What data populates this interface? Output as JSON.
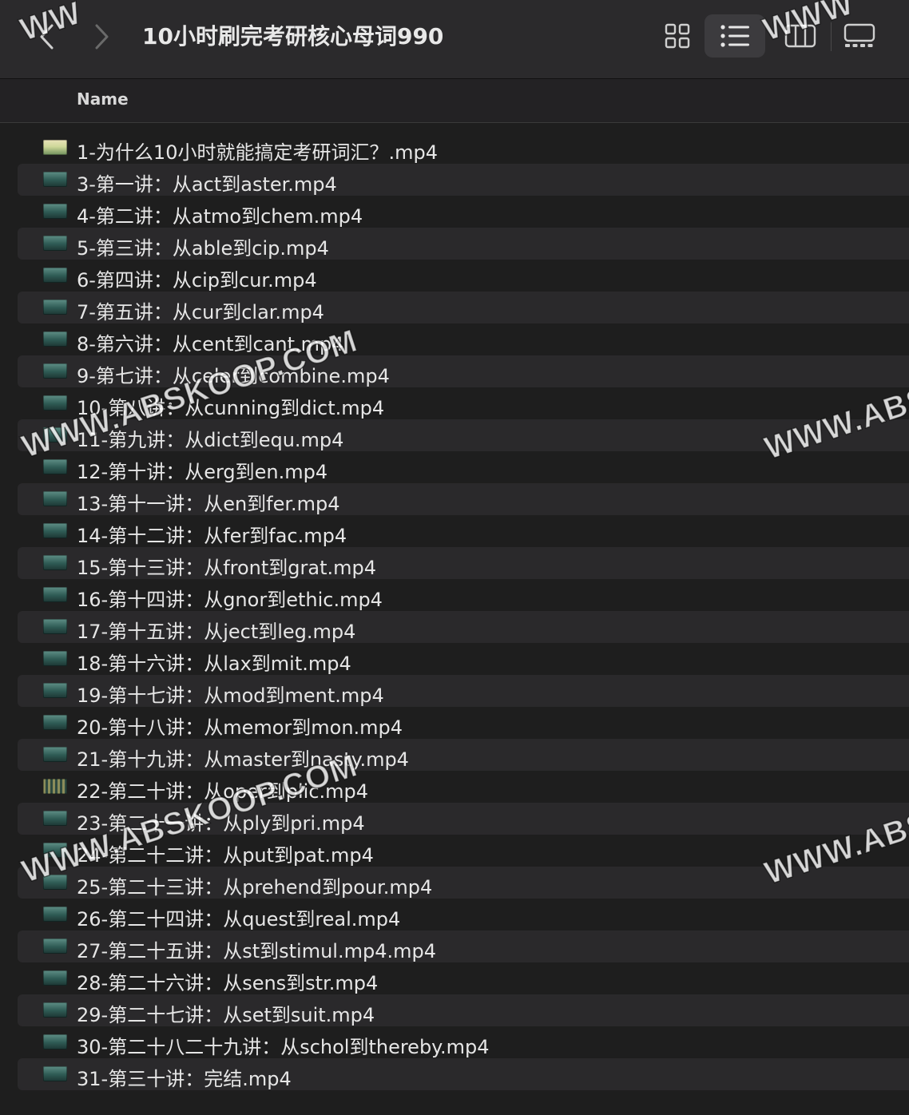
{
  "window": {
    "title": "10小时刷完考研核心母词990"
  },
  "toolbar": {
    "back_icon": "chevron-left-icon",
    "forward_icon": "chevron-right-icon",
    "views": [
      "icon-view",
      "list-view",
      "column-view",
      "gallery-view"
    ],
    "selected_view": "list-view"
  },
  "list_header": {
    "name_label": "Name"
  },
  "files": [
    {
      "name": "1-为什么10小时就能搞定考研词汇？.mp4"
    },
    {
      "name": "3-第一讲：从act到aster.mp4"
    },
    {
      "name": "4-第二讲：从atmo到chem.mp4"
    },
    {
      "name": "5-第三讲：从able到cip.mp4"
    },
    {
      "name": "6-第四讲：从cip到cur.mp4"
    },
    {
      "name": "7-第五讲：从cur到clar.mp4"
    },
    {
      "name": "8-第六讲：从cent到cant.mp4"
    },
    {
      "name": "9-第七讲：从celer到combine.mp4"
    },
    {
      "name": "10-第八讲：从cunning到dict.mp4"
    },
    {
      "name": "11-第九讲：从dict到equ.mp4"
    },
    {
      "name": "12-第十讲：从erg到en.mp4"
    },
    {
      "name": "13-第十一讲：从en到fer.mp4"
    },
    {
      "name": "14-第十二讲：从fer到fac.mp4"
    },
    {
      "name": "15-第十三讲：从front到grat.mp4"
    },
    {
      "name": "16-第十四讲：从gnor到ethic.mp4"
    },
    {
      "name": "17-第十五讲：从ject到leg.mp4"
    },
    {
      "name": "18-第十六讲：从lax到mit.mp4"
    },
    {
      "name": "19-第十七讲：从mod到ment.mp4"
    },
    {
      "name": "20-第十八讲：从memor到mon.mp4"
    },
    {
      "name": "21-第十九讲：从master到nasty.mp4"
    },
    {
      "name": "22-第二十讲：从oper到plic.mp4"
    },
    {
      "name": "23-第二十一讲：从ply到pri.mp4"
    },
    {
      "name": "24-第二十二讲：从put到pat.mp4"
    },
    {
      "name": "25-第二十三讲：从prehend到pour.mp4"
    },
    {
      "name": "26-第二十四讲：从quest到real.mp4"
    },
    {
      "name": "27-第二十五讲：从st到stimul.mp4.mp4"
    },
    {
      "name": "28-第二十六讲：从sens到str.mp4"
    },
    {
      "name": "29-第二十七讲：从set到suit.mp4"
    },
    {
      "name": "30-第二十八二十九讲：从schol到thereby.mp4"
    },
    {
      "name": "31-第三十讲：完结.mp4"
    }
  ],
  "watermark": {
    "text": "WWW.ABSKOOP.COM",
    "partial": "WWW.ABS",
    "top_left": "WW",
    "top_right": "WWW"
  },
  "colors": {
    "background": "#1e1e1e",
    "toolbar": "#2b2a2c",
    "row_alt": "#2a292b",
    "text": "#e6e6e6",
    "selected_view_bg": "#3c3b3e"
  }
}
